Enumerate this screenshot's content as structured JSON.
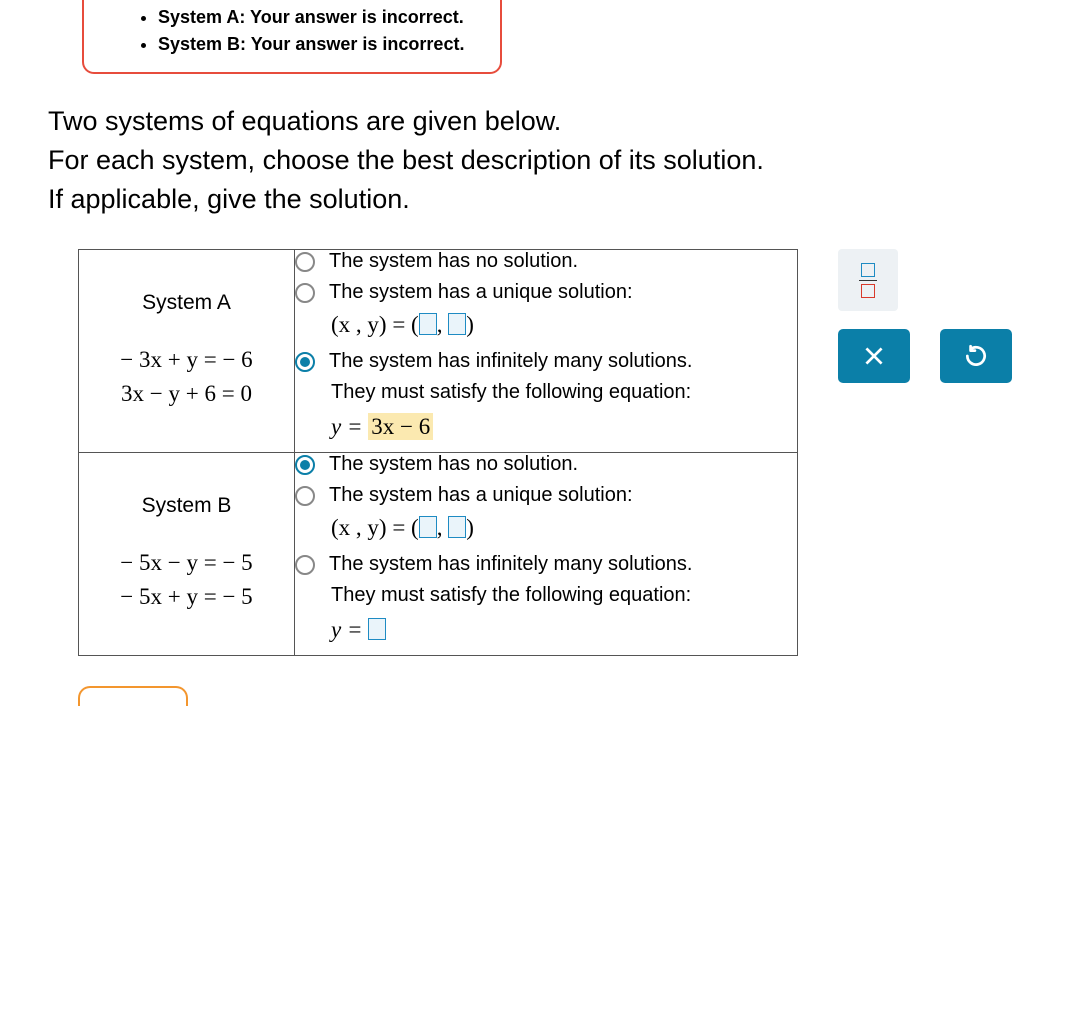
{
  "feedback": {
    "items": [
      "System A: Your answer is incorrect.",
      "System B: Your answer is incorrect."
    ]
  },
  "instructions": {
    "line1": "Two systems of equations are given below.",
    "line2": "For each system, choose the best description of its solution.",
    "line3": "If applicable, give the solution."
  },
  "systemA": {
    "label": "System A",
    "eq1": "− 3x + y = − 6",
    "eq2": "3x − y + 6 = 0",
    "opts": {
      "noSolution": "The system has no solution.",
      "unique": "The system has a unique solution:",
      "uniqueExprPrefix": "(x , y) = ",
      "infinite": "The system has infinitely many solutions.",
      "satisfy": "They must satisfy the following equation:",
      "yEqPrefix": "y = ",
      "yEqValue": "3x − 6",
      "selected": "infinite"
    }
  },
  "systemB": {
    "label": "System B",
    "eq1": "− 5x − y = − 5",
    "eq2": "− 5x + y = − 5",
    "opts": {
      "noSolution": "The system has no solution.",
      "unique": "The system has a unique solution:",
      "uniqueExprPrefix": "(x , y) = ",
      "infinite": "The system has infinitely many solutions.",
      "satisfy": "They must satisfy the following equation:",
      "yEqPrefix": "y = ",
      "selected": "noSolution"
    }
  },
  "tools": {
    "fraction": "fraction",
    "close": "close",
    "reset": "reset"
  }
}
